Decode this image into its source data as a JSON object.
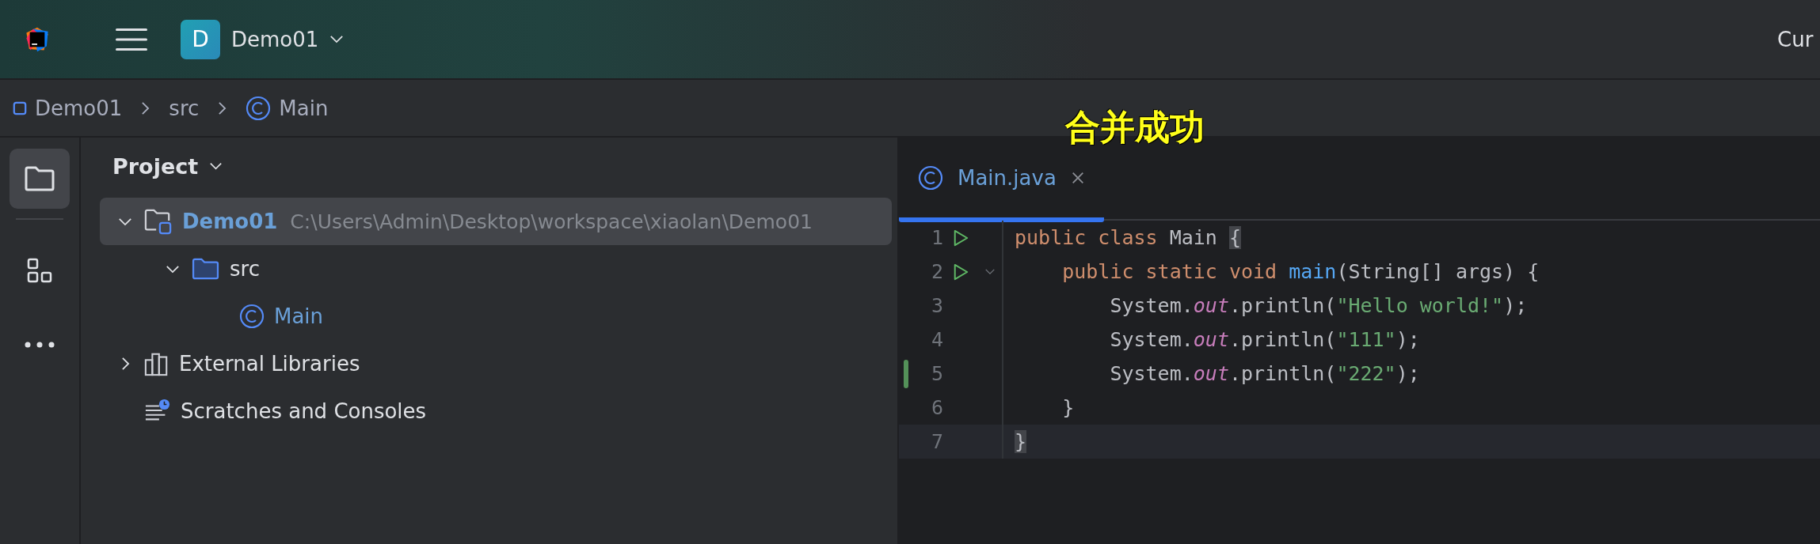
{
  "top_bar": {
    "project_badge": "D",
    "project_name": "Demo01",
    "right_text": "Cur"
  },
  "breadcrumb": [
    {
      "label": "Demo01",
      "kind": "module"
    },
    {
      "label": "src",
      "kind": "folder"
    },
    {
      "label": "Main",
      "kind": "class"
    }
  ],
  "tool_strip": [
    {
      "kind": "project",
      "selected": true
    },
    {
      "kind": "structure",
      "selected": false
    },
    {
      "kind": "more",
      "selected": false
    }
  ],
  "project_panel": {
    "title": "Project",
    "tree": [
      {
        "label": "Demo01",
        "path": "C:\\Users\\Admin\\Desktop\\workspace\\xiaolan\\Demo01",
        "kind": "module",
        "expanded": true,
        "selected": true,
        "children": [
          {
            "label": "src",
            "kind": "folder",
            "expanded": true,
            "selected": false,
            "children": [
              {
                "label": "Main",
                "kind": "class",
                "selected": false
              }
            ]
          }
        ]
      },
      {
        "label": "External Libraries",
        "kind": "libraries",
        "expanded": false,
        "selected": false
      },
      {
        "label": "Scratches and Consoles",
        "kind": "scratches",
        "selected": false
      }
    ]
  },
  "caption": "合并成功",
  "editor": {
    "tabs": [
      {
        "label": "Main.java",
        "selected": true
      }
    ],
    "lines": [
      {
        "number": "1",
        "run": true,
        "fold": false,
        "changed": false,
        "current": false,
        "tokens": [
          {
            "t": "public class ",
            "kind": "keyword"
          },
          {
            "t": "Main ",
            "kind": "plain"
          },
          {
            "t": "{",
            "kind": "match"
          }
        ]
      },
      {
        "number": "2",
        "run": true,
        "fold": true,
        "changed": false,
        "current": false,
        "tokens": [
          {
            "t": "    public static void ",
            "kind": "keyword"
          },
          {
            "t": "main",
            "kind": "method"
          },
          {
            "t": "(String[] args) {",
            "kind": "plain"
          }
        ]
      },
      {
        "number": "3",
        "run": false,
        "fold": false,
        "changed": false,
        "current": false,
        "tokens": [
          {
            "t": "        System.",
            "kind": "plain"
          },
          {
            "t": "out",
            "kind": "field"
          },
          {
            "t": ".println(",
            "kind": "plain"
          },
          {
            "t": "\"Hello world!\"",
            "kind": "string"
          },
          {
            "t": ");",
            "kind": "plain"
          }
        ]
      },
      {
        "number": "4",
        "run": false,
        "fold": false,
        "changed": false,
        "current": false,
        "tokens": [
          {
            "t": "        System.",
            "kind": "plain"
          },
          {
            "t": "out",
            "kind": "field"
          },
          {
            "t": ".println(",
            "kind": "plain"
          },
          {
            "t": "\"111\"",
            "kind": "string"
          },
          {
            "t": ");",
            "kind": "plain"
          }
        ]
      },
      {
        "number": "5",
        "run": false,
        "fold": false,
        "changed": true,
        "current": false,
        "tokens": [
          {
            "t": "        System.",
            "kind": "plain"
          },
          {
            "t": "out",
            "kind": "field"
          },
          {
            "t": ".println(",
            "kind": "plain"
          },
          {
            "t": "\"222\"",
            "kind": "string"
          },
          {
            "t": ");",
            "kind": "plain"
          }
        ]
      },
      {
        "number": "6",
        "run": false,
        "fold": false,
        "changed": false,
        "current": false,
        "tokens": [
          {
            "t": "    }",
            "kind": "plain"
          }
        ]
      },
      {
        "number": "7",
        "run": false,
        "fold": false,
        "changed": false,
        "current": true,
        "tokens": [
          {
            "t": "}",
            "kind": "match"
          }
        ]
      }
    ]
  }
}
